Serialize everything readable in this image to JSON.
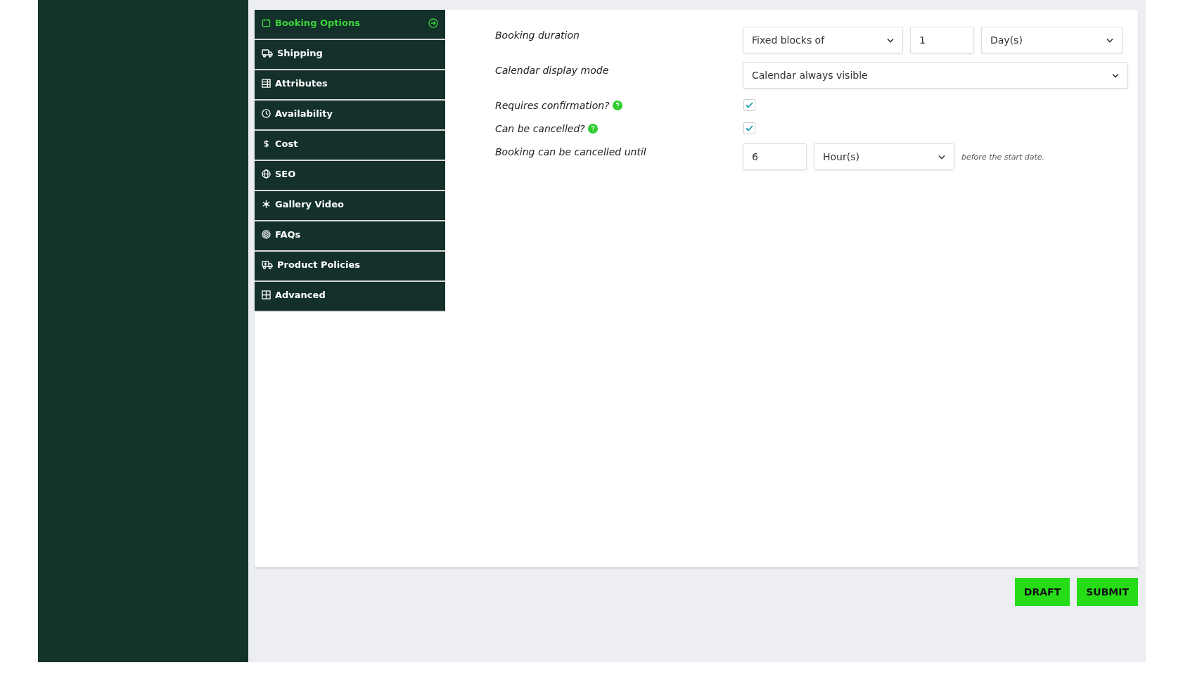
{
  "nav": [
    {
      "label": "Booking Options",
      "selected": true
    },
    {
      "label": "Shipping",
      "selected": false
    },
    {
      "label": "Attributes",
      "selected": false
    },
    {
      "label": "Availability",
      "selected": false
    },
    {
      "label": "Cost",
      "selected": false
    },
    {
      "label": "SEO",
      "selected": false
    },
    {
      "label": "Gallery Video",
      "selected": false
    },
    {
      "label": "FAQs",
      "selected": false
    },
    {
      "label": "Product Policies",
      "selected": false
    },
    {
      "label": "Advanced",
      "selected": false
    }
  ],
  "form": {
    "rows": [
      {
        "kind": "fields",
        "label": "Booking duration",
        "fields": [
          {
            "kind": "select",
            "value": "Fixed blocks of"
          },
          {
            "kind": "input",
            "value": "1"
          },
          {
            "kind": "select",
            "value": "Day(s)"
          }
        ]
      },
      {
        "kind": "fields",
        "label": "Calendar display mode",
        "fields": [
          {
            "kind": "select",
            "value": "Calendar always visible"
          }
        ]
      },
      {
        "kind": "checkbox",
        "label": "Requires confirmation?",
        "help": true,
        "checked": true
      },
      {
        "kind": "checkbox",
        "label": "Can be cancelled?",
        "help": true,
        "checked": true
      },
      {
        "kind": "fields",
        "label": "Booking can be cancelled until",
        "fields": [
          {
            "kind": "input",
            "value": "6"
          },
          {
            "kind": "select",
            "value": "Hour(s)"
          }
        ],
        "suffix": "before the start date."
      }
    ]
  },
  "actions": [
    {
      "label": "DRAFT"
    },
    {
      "label": "SUBMIT"
    }
  ]
}
